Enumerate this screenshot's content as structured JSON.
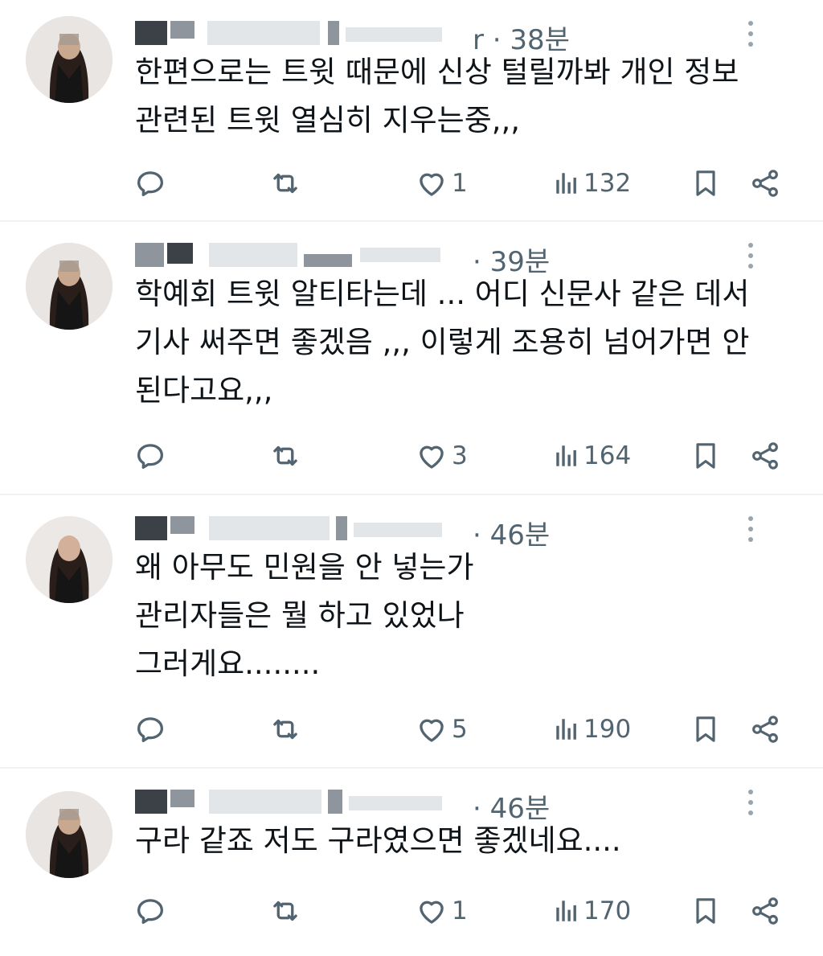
{
  "icons": {
    "reply": "reply-icon",
    "retweet": "retweet-icon",
    "like": "heart-icon",
    "views": "views-icon",
    "bookmark": "bookmark-icon",
    "share": "share-icon",
    "more": "more-icon"
  },
  "colors": {
    "text": "#0f1419",
    "secondary": "#536471",
    "divider": "#eff3f4"
  },
  "tweets": [
    {
      "time": "· 38분",
      "name_visible_fragment": "r",
      "text": "한편으로는 트윗 때문에 신상 털릴까봐 개인 정보\n관련된 트윗 열심히 지우는중,,,",
      "likes": "1",
      "views": "132"
    },
    {
      "time": "· 39분",
      "name_visible_fragment": "",
      "text": "학예회 트윗 알티타는데 ... 어디 신문사 같은 데서\n기사 써주면 좋겠음 ,,, 이렇게 조용히 넘어가면 안\n된다고요,,,",
      "likes": "3",
      "views": "164"
    },
    {
      "time": "· 46분",
      "name_visible_fragment": "",
      "text": "왜 아무도 민원을 안 넣는가\n관리자들은 뭘 하고 있었나\n그러게요........",
      "likes": "5",
      "views": "190"
    },
    {
      "time": "· 46분",
      "name_visible_fragment": "",
      "text": "구라 같죠 저도 구라였으면 좋겠네요....",
      "likes": "1",
      "views": "170"
    }
  ]
}
